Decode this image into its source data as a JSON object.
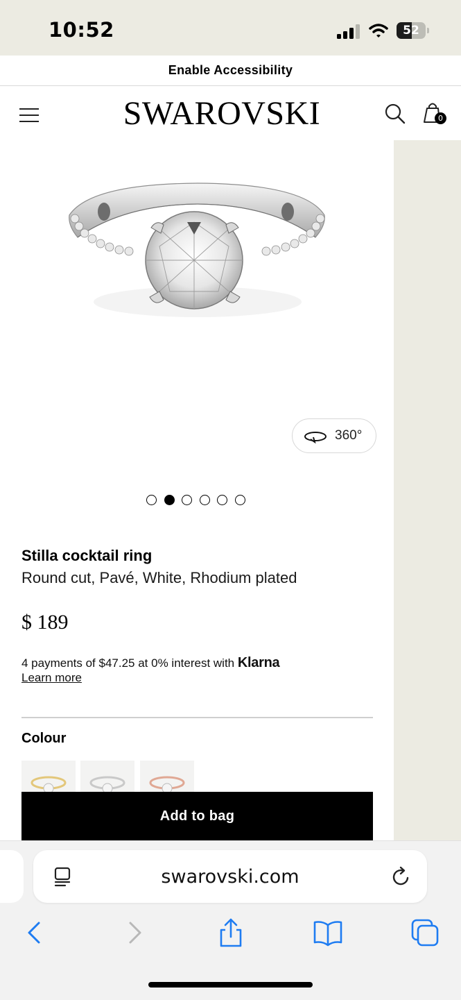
{
  "status_bar": {
    "time": "10:52",
    "battery": "52",
    "battery_level": 0.52
  },
  "banner": {
    "accessibility": "Enable Accessibility"
  },
  "header": {
    "brand": "SWAROVSKI",
    "bag_count": "0"
  },
  "gallery": {
    "view_360_label": "360°",
    "dots_total": 6,
    "active_dot": 2
  },
  "product": {
    "name": "Stilla cocktail ring",
    "description": "Round cut, Pavé, White, Rhodium plated",
    "price": "$ 189",
    "klarna_text": "4 payments of $47.25 at 0% interest with",
    "klarna_brand": "Klarna",
    "learn_more": "Learn more",
    "colour_label": "Colour",
    "add_to_bag": "Add to bag"
  },
  "colours": [
    {
      "name": "gold",
      "hex": "#e3c77a"
    },
    {
      "name": "rhodium",
      "hex": "#c9c9c9"
    },
    {
      "name": "rose-gold",
      "hex": "#e0a894"
    }
  ],
  "browser": {
    "url": "swarovski.com"
  },
  "theme": {
    "panel_color": "#ecebe2",
    "button_color": "#000000",
    "ios_blue": "#1e7cf2"
  },
  "icons": [
    "menu-icon",
    "search-icon",
    "bag-icon",
    "rotate-360-icon",
    "reader-icon",
    "reload-icon",
    "back-icon",
    "forward-icon",
    "share-icon",
    "bookmarks-icon",
    "tabs-icon"
  ]
}
